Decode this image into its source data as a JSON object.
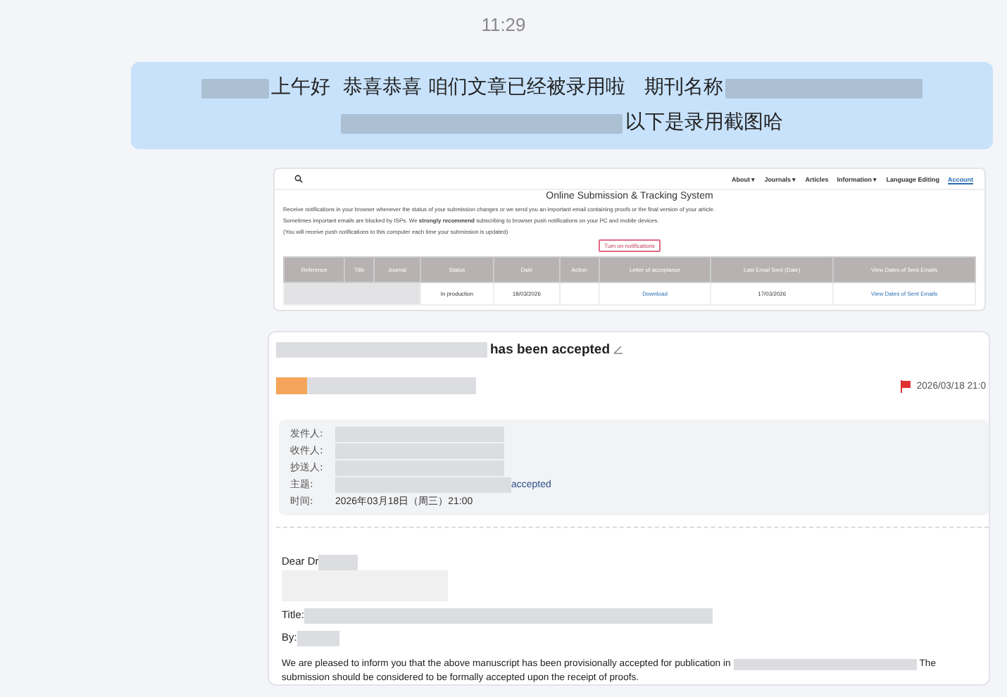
{
  "time": "11:29",
  "message": {
    "lines": [
      "上午好  恭喜恭喜 咱们文章已经被录用啦   期刊名称",
      "以下是录用截图哈"
    ]
  },
  "screenshot": {
    "nav": [
      {
        "label": "About ▾",
        "kind": "menu"
      },
      {
        "label": "Journals ▾",
        "kind": "menu"
      },
      {
        "label": "Articles",
        "kind": "menu"
      },
      {
        "label": "Information ▾",
        "kind": "menu"
      },
      {
        "label": "Language Editing",
        "kind": "menu"
      },
      {
        "label": "Account",
        "kind": "link"
      }
    ],
    "title": "Online Submission & Tracking System",
    "paragraphs": [
      "Receive notifications in your browser whenever the status of your submission changes or we send you an important email containing proofs or the final version of your article.",
      "Sometimes important emails are blocked by ISPs. We **strongly recommend** subscribing to browser push notifications on your PC and mobile devices.",
      "(You will receive push notifications to this computer each time your submission is updated)"
    ],
    "button": "Turn on notifications",
    "columns": [
      "Reference",
      "Title",
      "Journal",
      "Status",
      "Date",
      "Action",
      "Letter of acceptance",
      "Last Email Sent (Date)",
      "View Dates of Sent Emails"
    ],
    "row": [
      {
        "kind": "redacted"
      },
      {
        "kind": "text",
        "text": "In production"
      },
      {
        "kind": "text",
        "text": "18/03/2026"
      },
      {
        "kind": "blank"
      },
      {
        "kind": "link",
        "text": "Download"
      },
      {
        "kind": "text",
        "text": "17/03/2026"
      },
      {
        "kind": "link",
        "text": "View Dates of Sent Emails"
      }
    ]
  },
  "email": {
    "subject": "has been accepted",
    "date": "2026/03/18 21:0",
    "fields": [
      {
        "label": "发件人:"
      },
      {
        "label": "收件人:"
      },
      {
        "label": "抄送人:"
      },
      {
        "label": "主题:",
        "value": "accepted"
      },
      {
        "label": "时间:",
        "value": "2026年03月18日（周三）21:00"
      }
    ],
    "greeting": "Dear Dr",
    "title_label": "Title:",
    "by_label": "By:",
    "body_start": "We are pleased to inform you that the above manuscript has been provisionally accepted for publication in",
    "body_end": [
      "The",
      "submission should be considered to be formally accepted upon the receipt of proofs."
    ]
  }
}
